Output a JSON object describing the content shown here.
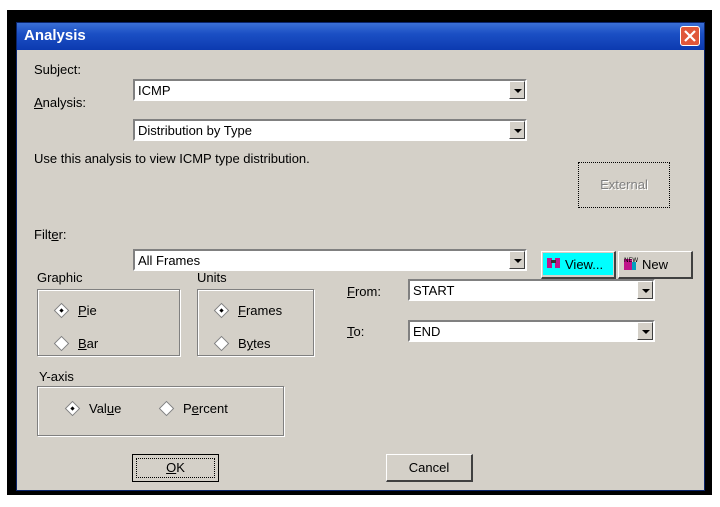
{
  "window": {
    "title": "Analysis"
  },
  "subject": {
    "label": "Subject:",
    "value": "ICMP"
  },
  "analysis": {
    "label_u": "A",
    "label_rest": "nalysis:",
    "value": "Distribution by Type",
    "description": "Use this analysis to view ICMP type distribution."
  },
  "external_button": "External",
  "filter": {
    "label_pre": "Filt",
    "label_u": "e",
    "label_rest": "r:",
    "value": "All Frames",
    "view_button": "View...",
    "new_button": "New"
  },
  "graphic": {
    "title": "Graphic",
    "pie": {
      "u": "P",
      "rest": "ie",
      "selected": true
    },
    "bar": {
      "u": "B",
      "rest": "ar",
      "selected": false
    }
  },
  "units": {
    "title": "Units",
    "frames": {
      "u": "F",
      "rest": "rames",
      "selected": true
    },
    "bytes": {
      "pre": "B",
      "u": "y",
      "rest": "tes",
      "selected": false
    }
  },
  "from": {
    "label_u": "F",
    "label_rest": "rom:",
    "value": "START"
  },
  "to": {
    "label_u": "T",
    "label_rest": "o:",
    "value": "END"
  },
  "yaxis": {
    "title": "Y-axis",
    "value": {
      "pre": "Val",
      "u": "u",
      "rest": "e",
      "selected": true
    },
    "percent": {
      "pre": "P",
      "u": "e",
      "rest": "rcent",
      "selected": false
    }
  },
  "ok_button": {
    "u": "O",
    "rest": "K"
  },
  "cancel_button": "Cancel"
}
